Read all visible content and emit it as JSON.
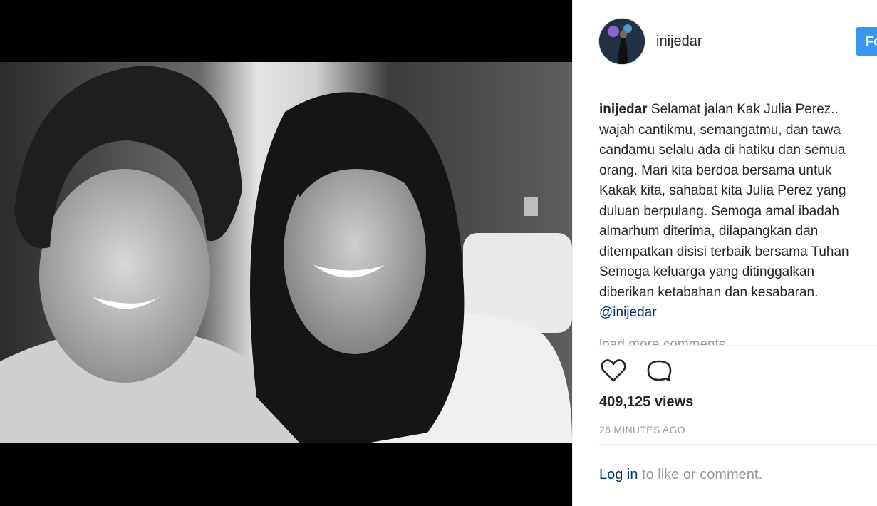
{
  "post": {
    "username": "inijedar",
    "follow_label": "Follow",
    "caption": {
      "username": "inijedar",
      "lines": [
        "Selamat jalan Kak Julia Perez..",
        "wajah cantikmu, semangatmu, dan tawa",
        "candamu selalu ada di hatiku dan semua",
        "orang. Mari kita berdoa bersama untuk",
        "Kakak kita, sahabat kita Julia Perez yang",
        "duluan berpulang. Semoga amal ibadah",
        "almarhum diterima, dilapangkan dan",
        "ditempatkan disisi terbaik bersama Tuhan",
        "Semoga keluarga yang ditinggalkan",
        "diberikan ketabahan dan kesabaran."
      ],
      "mention": "@inijedar"
    },
    "load_more": "load more comments",
    "views_count": "409,125",
    "views_label": "views",
    "time_ago": "26 MINUTES AGO",
    "login_link": "Log in",
    "login_suffix": " to like or comment."
  },
  "icons": {
    "like": "heart-icon",
    "comment": "comment-icon"
  },
  "colors": {
    "follow_button": "#3897f0",
    "link": "#003569",
    "muted": "#999999",
    "text": "#262626"
  }
}
